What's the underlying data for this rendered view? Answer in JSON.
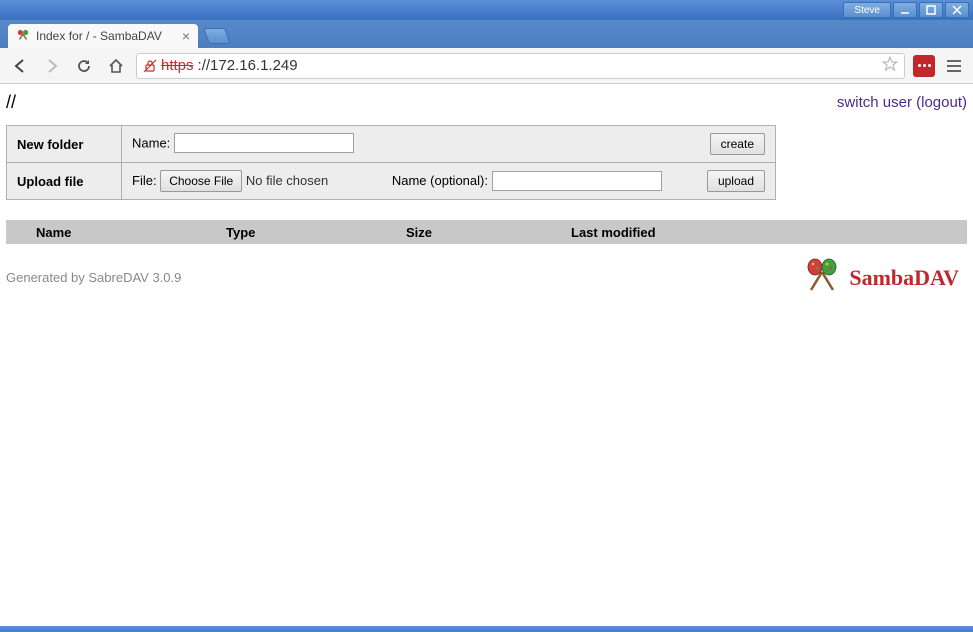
{
  "window": {
    "user_label": "Steve"
  },
  "tab": {
    "title": "Index for / - SambaDAV"
  },
  "address": {
    "protocol_display": "https",
    "rest": "://172.16.1.249"
  },
  "page": {
    "path": "//",
    "switch_user_label": "switch user",
    "logout_label": "logout"
  },
  "new_folder": {
    "title": "New folder",
    "name_label": "Name:",
    "create_label": "create"
  },
  "upload": {
    "title": "Upload file",
    "file_label": "File:",
    "choose_label": "Choose File",
    "no_file_label": "No file chosen",
    "name_opt_label": "Name (optional):",
    "upload_label": "upload"
  },
  "columns": {
    "name": "Name",
    "type": "Type",
    "size": "Size",
    "modified": "Last modified"
  },
  "footer": {
    "generated": "Generated by SabreDAV 3.0.9",
    "brand": "SambaDAV"
  }
}
